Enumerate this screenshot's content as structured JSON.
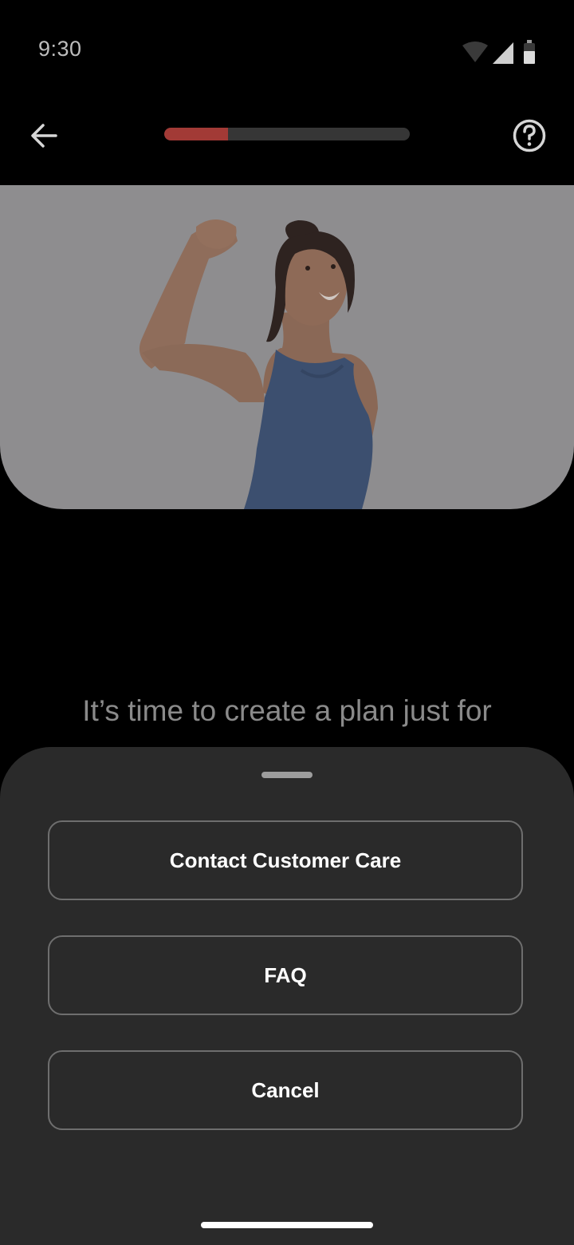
{
  "status_bar": {
    "time": "9:30",
    "icons": [
      "wifi-icon",
      "signal-icon",
      "battery-icon"
    ]
  },
  "header": {
    "back_icon": "arrow-left-icon",
    "help_icon": "question-circle-icon",
    "progress_fraction": 0.26,
    "progress_color": "#a23a36"
  },
  "hero": {
    "image": "woman-flexing-arm-photo"
  },
  "main": {
    "headline": "It’s time to create a plan just for"
  },
  "sheet": {
    "buttons": [
      {
        "label": "Contact Customer Care"
      },
      {
        "label": "FAQ"
      },
      {
        "label": "Cancel"
      }
    ]
  },
  "colors": {
    "background": "#000000",
    "sheet_background": "#2a2a2a",
    "button_border": "#6e6e6e",
    "accent": "#a23a36"
  }
}
